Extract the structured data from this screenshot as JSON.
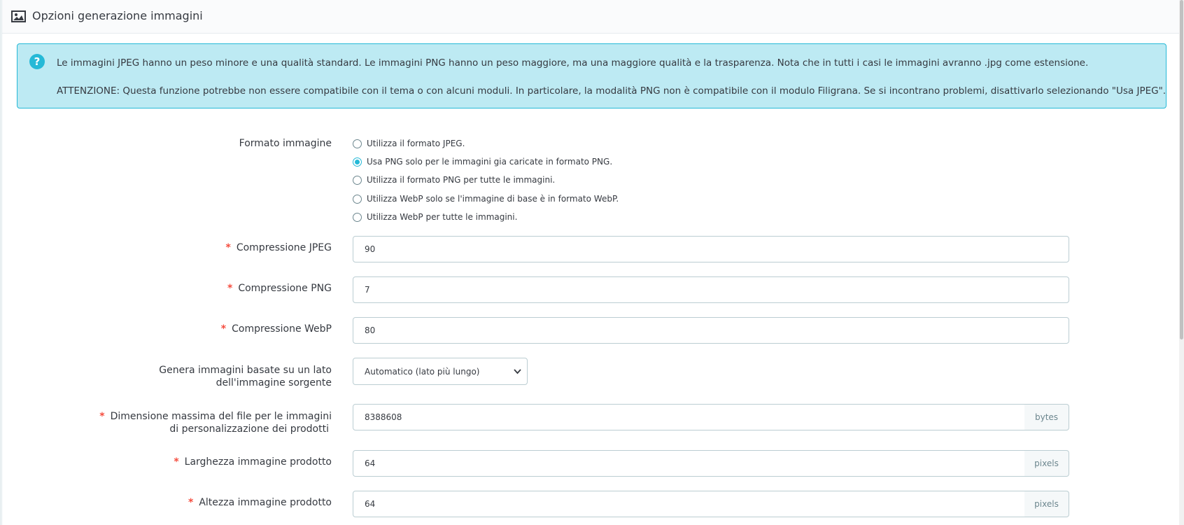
{
  "panel": {
    "title": "Opzioni generazione immagini",
    "heading_icon": "image-icon"
  },
  "alert": {
    "icon": "question-circle-icon",
    "line1": "Le immagini JPEG hanno un peso minore e una qualità standard. Le immagini PNG hanno un peso maggiore, ma una maggiore qualità e la trasparenza. Nota che in tutti i casi le immagini avranno .jpg come estensione.",
    "line2": "ATTENZIONE: Questa funzione potrebbe non essere compatibile con il tema o con alcuni moduli. In particolare, la modalità PNG non è compatibile con il modulo Filigrana. Se si incontrano problemi, disattivarlo selezionando \"Usa JPEG\"."
  },
  "format": {
    "label": "Formato immagine",
    "options": [
      {
        "label": "Utilizza il formato JPEG.",
        "checked": false
      },
      {
        "label": "Usa PNG solo per le immagini gia caricate in formato PNG.",
        "checked": true
      },
      {
        "label": "Utilizza il formato PNG per tutte le immagini.",
        "checked": false
      },
      {
        "label": "Utilizza WebP solo se l'immagine di base è in formato WebP.",
        "checked": false
      },
      {
        "label": "Utilizza WebP per tutte le immagini.",
        "checked": false
      }
    ]
  },
  "fields": {
    "required_mark": "*",
    "jpeg": {
      "label": "Compressione JPEG",
      "value": "90"
    },
    "png": {
      "label": "Compressione PNG",
      "value": "7"
    },
    "webp": {
      "label": "Compressione WebP",
      "value": "80"
    },
    "side": {
      "label_line1": "Genera immagini basate su un lato",
      "label_line2": "dell'immagine sorgente",
      "selected": "Automatico (lato più lungo)"
    },
    "max_size": {
      "label_line1": "Dimensione massima del file per le immagini",
      "label_line2": "di personalizzazione dei prodotti",
      "value": "8388608",
      "unit": "bytes"
    },
    "width": {
      "label": "Larghezza immagine prodotto",
      "value": "64",
      "unit": "pixels"
    },
    "height": {
      "label": "Altezza immagine prodotto",
      "value": "64",
      "unit": "pixels"
    }
  },
  "colors": {
    "info_bg": "#bdeaf3",
    "info_border": "#25b9d7",
    "required": "#f54c3e"
  }
}
